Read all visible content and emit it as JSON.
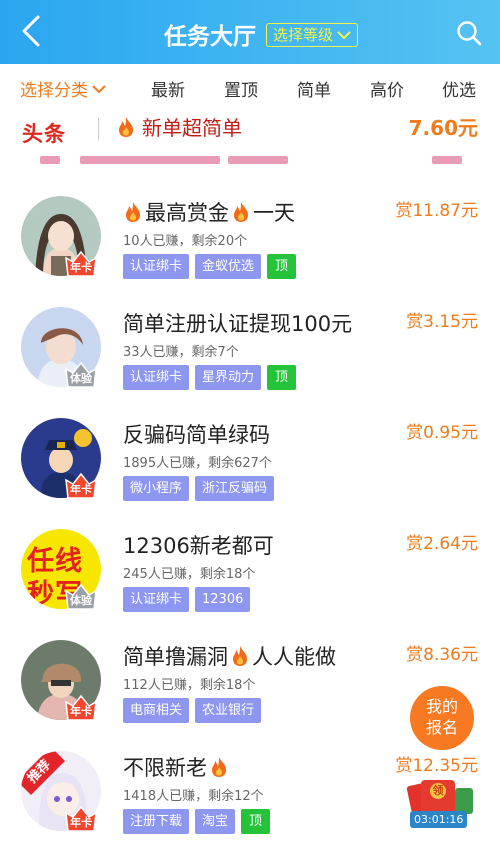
{
  "header": {
    "title": "任务大厅",
    "level_label": "选择等级"
  },
  "filters": [
    {
      "label": "选择分类"
    },
    {
      "label": "最新"
    },
    {
      "label": "置顶"
    },
    {
      "label": "简单"
    },
    {
      "label": "高价"
    },
    {
      "label": "优选"
    }
  ],
  "ticker": {
    "logo": "头条",
    "text": "新单超简单",
    "price": "7.60元"
  },
  "tasks": [
    {
      "title_a": "最高赏金",
      "title_b": "一天",
      "sub": "10人已赚，剩余20个",
      "tags": [
        "认证绑卡",
        "金蚁优选"
      ],
      "top": "顶",
      "reward": "赏11.87元",
      "badge": "年卡"
    },
    {
      "title_a": "简单注册认证提现100元",
      "title_b": "",
      "sub": "33人已赚，剩余7个",
      "tags": [
        "认证绑卡",
        "星界动力"
      ],
      "top": "顶",
      "reward": "赏3.15元",
      "badge": "体验"
    },
    {
      "title_a": "反骗码简单绿码",
      "title_b": "",
      "sub": "1895人已赚，剩余627个",
      "tags": [
        "微小程序",
        "浙江反骗码"
      ],
      "top": "",
      "reward": "赏0.95元",
      "badge": "年卡"
    },
    {
      "title_a": "12306新老都可",
      "title_b": "",
      "sub": "245人已赚，剩余18个",
      "tags": [
        "认证绑卡",
        "12306"
      ],
      "top": "",
      "reward": "赏2.64元",
      "badge": "体验",
      "avatar_text_1": "任线",
      "avatar_text_2": "秒写"
    },
    {
      "title_a": "简单撸漏洞",
      "title_b": "人人能做",
      "sub": "112人已赚，剩余18个",
      "tags": [
        "电商相关",
        "农业银行"
      ],
      "top": "",
      "reward": "赏8.36元",
      "badge": "年卡"
    },
    {
      "title_a": "不限新老",
      "title_b": "",
      "sub": "1418人已赚，剩余12个",
      "tags": [
        "注册下载",
        "淘宝"
      ],
      "top": "顶",
      "reward": "赏12.35元",
      "badge": "年卡",
      "avatar_text_1": "推荐"
    }
  ],
  "float": {
    "line1": "我的",
    "line2": "报名",
    "redpack_label": "领",
    "timer": "03:01:16"
  },
  "colors": {
    "header": "#2aa6f0",
    "accent": "#f07b1c",
    "tag": "#8e97f0",
    "top_tag": "#24c33a"
  }
}
